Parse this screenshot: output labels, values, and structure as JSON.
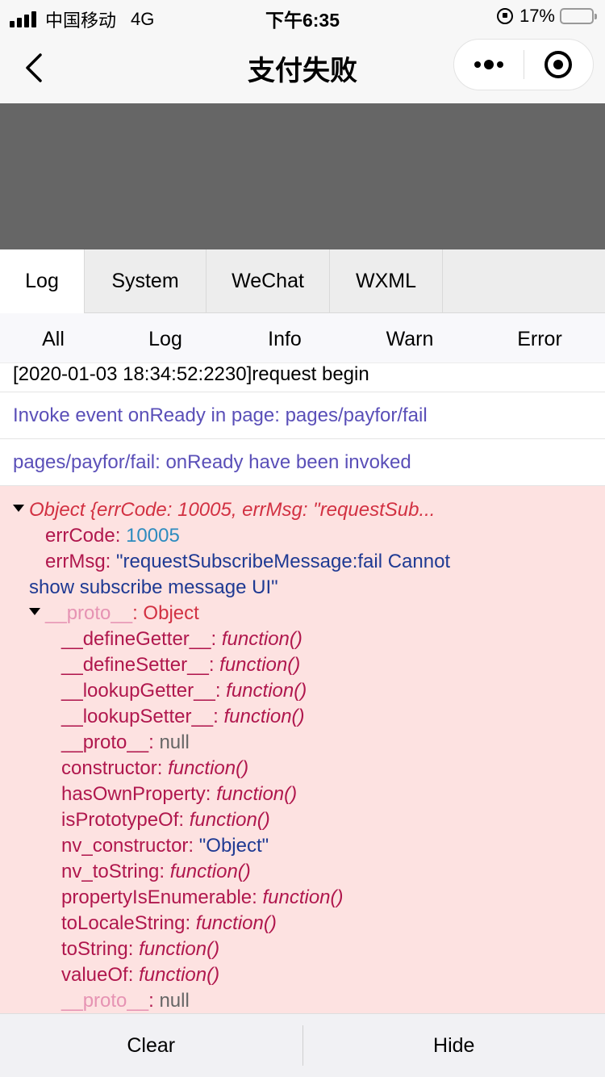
{
  "status_bar": {
    "carrier": "中国移动",
    "network": "4G",
    "time": "下午6:35",
    "battery_percent": "17%",
    "battery_level": 0.17,
    "battery_color": "#f5c12b"
  },
  "nav": {
    "title": "支付失败",
    "back_icon": "chevron-left-icon",
    "more_icon": "more-dots-icon",
    "close_icon": "target-circle-icon"
  },
  "vconsole": {
    "tabs": [
      {
        "label": "Log",
        "active": true
      },
      {
        "label": "System",
        "active": false
      },
      {
        "label": "WeChat",
        "active": false
      },
      {
        "label": "WXML",
        "active": false
      }
    ],
    "filters": [
      "All",
      "Log",
      "Info",
      "Warn",
      "Error"
    ]
  },
  "logs": {
    "request_begin": "[2020-01-03 18:34:52:2230]request begin",
    "on_ready_event": "Invoke event onReady in page: pages/payfor/fail",
    "on_ready_invoked": "pages/payfor/fail: onReady have been invoked"
  },
  "error_object": {
    "header": "Object {errCode: 10005, errMsg: \"requestSub...",
    "err_code_key": "errCode",
    "err_code_value": "10005",
    "err_msg_key": "errMsg",
    "err_msg_value_line1": "\"requestSubscribeMessage:fail Cannot",
    "err_msg_value_line2": "show subscribe message UI\"",
    "proto_key": "__proto__",
    "proto_value": ": Object",
    "proto_members": [
      {
        "key": "__defineGetter__",
        "value": "function()",
        "kind": "fn"
      },
      {
        "key": "__defineSetter__",
        "value": "function()",
        "kind": "fn"
      },
      {
        "key": "__lookupGetter__",
        "value": "function()",
        "kind": "fn"
      },
      {
        "key": "__lookupSetter__",
        "value": "function()",
        "kind": "fn"
      },
      {
        "key": "__proto__",
        "value": "null",
        "kind": "null"
      },
      {
        "key": "constructor",
        "value": "function()",
        "kind": "fn"
      },
      {
        "key": "hasOwnProperty",
        "value": "function()",
        "kind": "fn"
      },
      {
        "key": "isPrototypeOf",
        "value": "function()",
        "kind": "fn"
      },
      {
        "key": "nv_constructor",
        "value": "\"Object\"",
        "kind": "str"
      },
      {
        "key": "nv_toString",
        "value": "function()",
        "kind": "fn"
      },
      {
        "key": "propertyIsEnumerable",
        "value": "function()",
        "kind": "fn"
      },
      {
        "key": "toLocaleString",
        "value": "function()",
        "kind": "fn"
      },
      {
        "key": "toString",
        "value": "function()",
        "kind": "fn"
      },
      {
        "key": "valueOf",
        "value": "function()",
        "kind": "fn"
      },
      {
        "key": "__proto__",
        "value": "null",
        "kind": "null-pink"
      }
    ]
  },
  "bottom": {
    "clear_label": "Clear",
    "hide_label": "Hide"
  }
}
